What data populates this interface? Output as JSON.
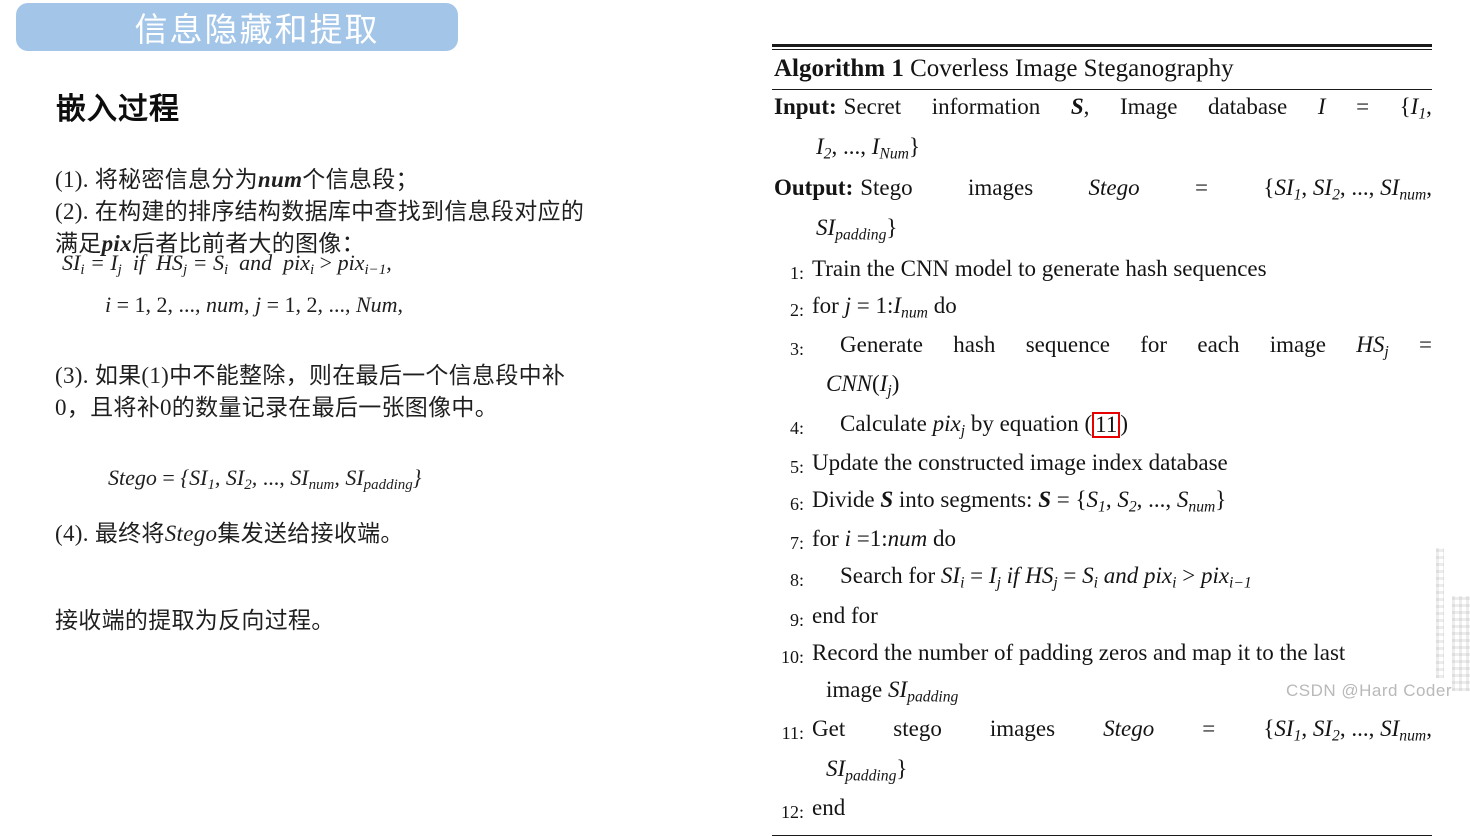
{
  "slide": {
    "banner_title": "信息隐藏和提取",
    "banner_color": "#a2c5e8",
    "section_heading": "嵌入过程",
    "paragraphs": {
      "item1": "(1). 将秘密信息分为num个信息段；",
      "item2": "(2). 在构建的排序结构数据库中查找到信息段对应的满足pix后者比前者大的图像：",
      "item3": "(3). 如果(1)中不能整除，则在最后一个信息段中补0，且将补0的数量记录在最后一张图像中。",
      "item4": "(4). 最终将Stego集发送给接收端。",
      "closing": "接收端的提取为反向过程。"
    },
    "formulas": {
      "formula1": "SI_i = I_j if HS_j = S_i and pix_i > pix_{i-1},",
      "formula2": "i = 1, 2, ..., num, j = 1, 2, ..., Num,",
      "formula3": "Stego = {SI_1, SI_2, ..., SI_num, SI_padding}"
    }
  },
  "algorithm": {
    "label": "Algorithm 1",
    "title": "Coverless Image Steganography",
    "input_label": "Input:",
    "input_text": "Secret information S, Image database I = {I_1, I_2, ..., I_Num}",
    "output_label": "Output:",
    "output_text": "Stego images Stego = {SI_1, SI_2, ..., SI_num, SI_padding}",
    "lines": [
      {
        "num": "1:",
        "text": "Train the CNN model to generate hash sequences"
      },
      {
        "num": "2:",
        "text": "for j = 1:I_num do"
      },
      {
        "num": "3:",
        "text": "Generate hash sequence for each image HS_j = CNN(I_j)"
      },
      {
        "num": "4:",
        "text": "Calculate pix_j by equation (11)"
      },
      {
        "num": "5:",
        "text": "Update the constructed image index database"
      },
      {
        "num": "6:",
        "text": "Divide S into segments: S = {S_1, S_2, ..., S_num}"
      },
      {
        "num": "7:",
        "text": "for i =1:num do"
      },
      {
        "num": "8:",
        "text": "Search for SI_i = I_j if HS_j = S_i and pix_i > pix_{i-1}"
      },
      {
        "num": "9:",
        "text": "end for"
      },
      {
        "num": "10:",
        "text": "Record the number of padding zeros and map it to the last image SI_padding"
      },
      {
        "num": "11:",
        "text": "Get stego images Stego = {SI_1, SI_2, ..., SI_num, SI_padding}"
      },
      {
        "num": "12:",
        "text": "end"
      }
    ],
    "equation_reference": "11",
    "equation_reference_highlight_color": "#e60000"
  },
  "watermark": {
    "text": "CSDN @Hard Coder"
  }
}
